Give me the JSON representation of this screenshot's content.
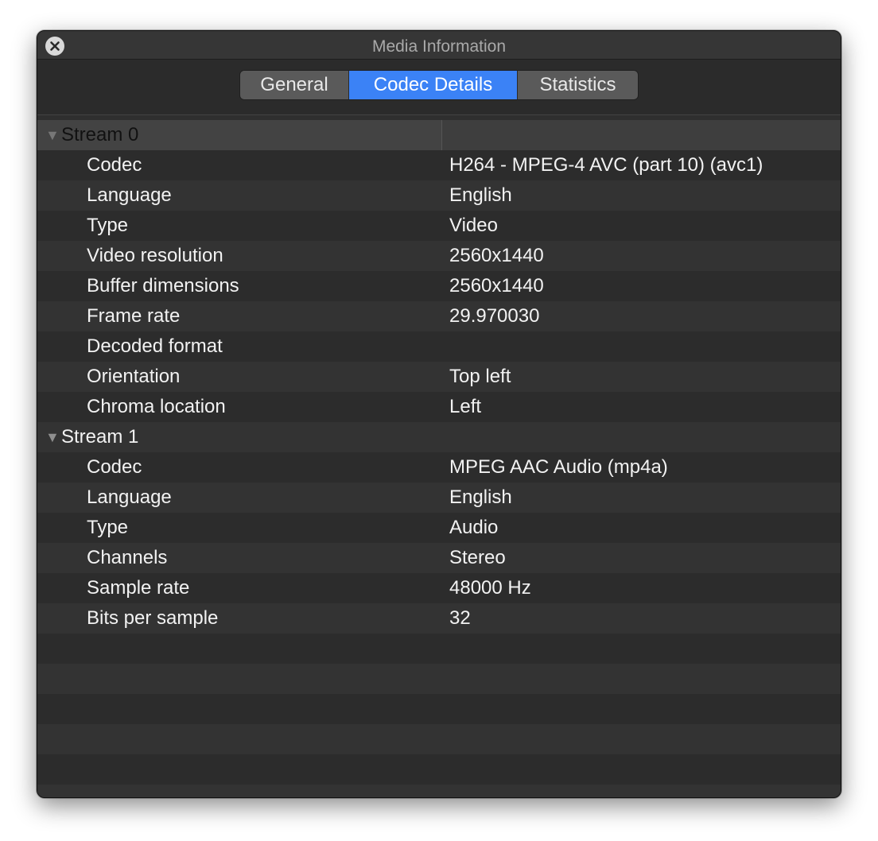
{
  "window": {
    "title": "Media Information"
  },
  "tabs": [
    {
      "label": "General",
      "active": false
    },
    {
      "label": "Codec Details",
      "active": true
    },
    {
      "label": "Statistics",
      "active": false
    }
  ],
  "streams": [
    {
      "label": "Stream 0",
      "expanded": true,
      "rows": [
        {
          "key": "Codec",
          "value": "H264 - MPEG-4 AVC (part 10) (avc1)"
        },
        {
          "key": "Language",
          "value": "English"
        },
        {
          "key": "Type",
          "value": "Video"
        },
        {
          "key": "Video resolution",
          "value": "2560x1440"
        },
        {
          "key": "Buffer dimensions",
          "value": "2560x1440"
        },
        {
          "key": "Frame rate",
          "value": "29.970030"
        },
        {
          "key": "Decoded format",
          "value": ""
        },
        {
          "key": "Orientation",
          "value": "Top left"
        },
        {
          "key": "Chroma location",
          "value": "Left"
        }
      ]
    },
    {
      "label": "Stream 1",
      "expanded": true,
      "rows": [
        {
          "key": "Codec",
          "value": "MPEG AAC Audio (mp4a)"
        },
        {
          "key": "Language",
          "value": "English"
        },
        {
          "key": "Type",
          "value": "Audio"
        },
        {
          "key": "Channels",
          "value": "Stereo"
        },
        {
          "key": "Sample rate",
          "value": "48000 Hz"
        },
        {
          "key": "Bits per sample",
          "value": "32"
        }
      ]
    }
  ],
  "colors": {
    "accent": "#3b82f6",
    "background": "#2f2f2f",
    "text": "#f2f2f2"
  }
}
